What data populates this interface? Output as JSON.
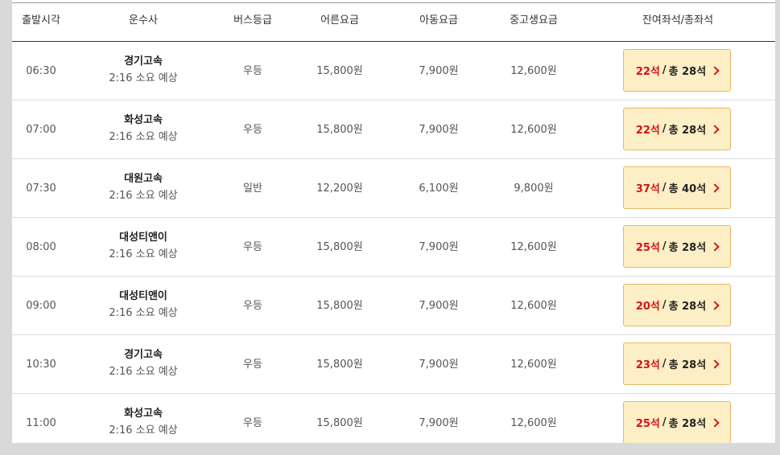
{
  "header": {
    "time": "출발시각",
    "company": "운수사",
    "grade": "버스등급",
    "adult": "어른요금",
    "child": "아동요금",
    "youth": "중고생요금",
    "seats": "잔여좌석/총좌석"
  },
  "rows": [
    {
      "time": "06:30",
      "company": "경기고속",
      "duration": "2:16 소요 예상",
      "grade": "우등",
      "adult": "15,800원",
      "child": "7,900원",
      "youth": "12,600원",
      "remain": "22석",
      "sep": "/",
      "total": "총 28석"
    },
    {
      "time": "07:00",
      "company": "화성고속",
      "duration": "2:16 소요 예상",
      "grade": "우등",
      "adult": "15,800원",
      "child": "7,900원",
      "youth": "12,600원",
      "remain": "22석",
      "sep": "/",
      "total": "총 28석"
    },
    {
      "time": "07:30",
      "company": "대원고속",
      "duration": "2:16 소요 예상",
      "grade": "일반",
      "adult": "12,200원",
      "child": "6,100원",
      "youth": "9,800원",
      "remain": "37석",
      "sep": "/",
      "total": "총 40석"
    },
    {
      "time": "08:00",
      "company": "대성티앤이",
      "duration": "2:16 소요 예상",
      "grade": "우등",
      "adult": "15,800원",
      "child": "7,900원",
      "youth": "12,600원",
      "remain": "25석",
      "sep": "/",
      "total": "총 28석"
    },
    {
      "time": "09:00",
      "company": "대성티앤이",
      "duration": "2:16 소요 예상",
      "grade": "우등",
      "adult": "15,800원",
      "child": "7,900원",
      "youth": "12,600원",
      "remain": "20석",
      "sep": "/",
      "total": "총 28석"
    },
    {
      "time": "10:30",
      "company": "경기고속",
      "duration": "2:16 소요 예상",
      "grade": "우등",
      "adult": "15,800원",
      "child": "7,900원",
      "youth": "12,600원",
      "remain": "23석",
      "sep": "/",
      "total": "총 28석"
    },
    {
      "time": "11:00",
      "company": "화성고속",
      "duration": "2:16 소요 예상",
      "grade": "우등",
      "adult": "15,800원",
      "child": "7,900원",
      "youth": "12,600원",
      "remain": "25석",
      "sep": "/",
      "total": "총 28석"
    }
  ],
  "icons": {
    "seat_button": "chevron-right-icon"
  },
  "colors": {
    "remain": "#d4131b",
    "button_bg": "#fdefc5",
    "button_border": "#e7b762"
  }
}
